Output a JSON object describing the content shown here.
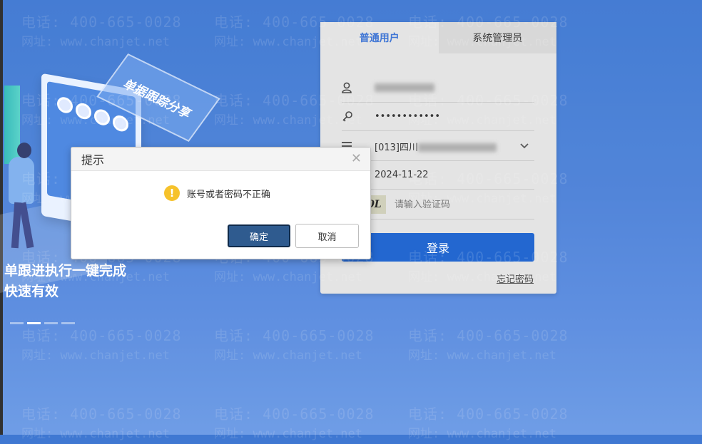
{
  "watermark": {
    "phone": "电话: 400-665-0028",
    "site": "网址: www.chanjet.net"
  },
  "illustration": {
    "banner": "单据跟踪分享"
  },
  "slogan": {
    "line1": "单跟进执行一键完成",
    "line2": "快速有效"
  },
  "login": {
    "tabs": [
      {
        "label": "普通用户",
        "active": true
      },
      {
        "label": "系统管理员",
        "active": false
      }
    ],
    "password_mask": "••••••••••••",
    "account_set": "[013]四川",
    "date": "2024-11-22",
    "captcha_text": "Y40L",
    "captcha_placeholder": "请输入验证码",
    "login_button": "登录",
    "forgot_link": "忘记密码"
  },
  "dialog": {
    "title": "提示",
    "message": "账号或者密码不正确",
    "ok_label": "确定",
    "cancel_label": "取消"
  },
  "colors": {
    "accent": "#1c63cf",
    "warning": "#f6c22b"
  }
}
